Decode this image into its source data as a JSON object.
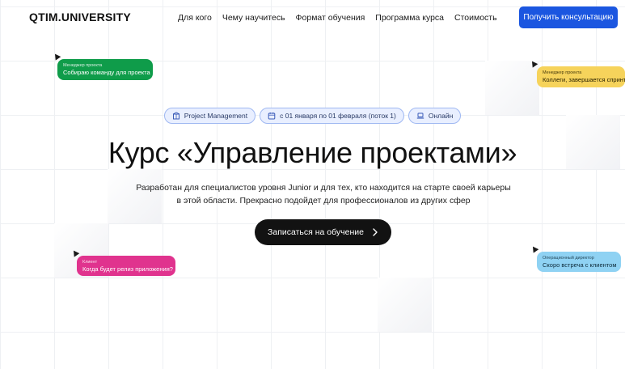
{
  "brand": {
    "logo": "QTIM.UNIVERSITY"
  },
  "nav": {
    "links": [
      "Для кого",
      "Чему научитесь",
      "Формат обучения",
      "Программа курса",
      "Стоимость"
    ],
    "cta": "Получить консультацию"
  },
  "bubbles": {
    "green": {
      "role": "Менеджер проекта",
      "msg": "Собираю команду для проекта",
      "color": "#0f9c4a"
    },
    "yellow": {
      "role": "Менеджер проекта",
      "msg": "Коллеги, завершается спринт",
      "color": "#f6d35b"
    },
    "pink": {
      "role": "Клиент",
      "msg": "Когда будет релиз приложения?",
      "color": "#e0338e"
    },
    "blue": {
      "role": "Операционный директор",
      "msg": "Скоро встреча с клиентом",
      "color": "#8fd2f3"
    }
  },
  "chips": [
    {
      "icon": "building-icon",
      "label": "Project Management"
    },
    {
      "icon": "calendar-icon",
      "label": "с 01 января по 01 февраля (поток 1)"
    },
    {
      "icon": "laptop-icon",
      "label": "Онлайн"
    }
  ],
  "hero": {
    "title": "Курс «Управление проектами»",
    "subtitle_line1": "Разработан для специалистов уровня Junior и для тех, кто находится на старте своей карьеры",
    "subtitle_line2": "в этой области. Прекрасно подойдет для профессионалов из других сфер",
    "cta": "Записаться на обучение"
  },
  "colors": {
    "accent": "#1b56e0",
    "dark": "#121212",
    "chip_bg": "#e9efff"
  }
}
